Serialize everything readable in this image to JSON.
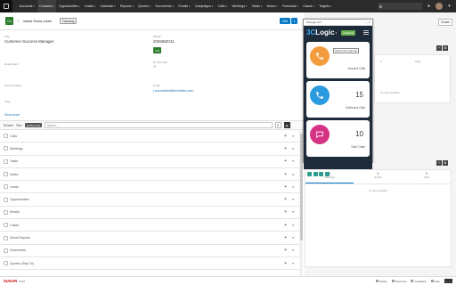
{
  "nav": {
    "items": [
      "Accounts",
      "Contacts",
      "Opportunities",
      "Leads",
      "Calendar",
      "Reports",
      "Quotes",
      "Documents",
      "Emails",
      "Campaigns",
      "Calls",
      "Meetings",
      "Tasks",
      "Notes",
      "Forecasts",
      "Cases",
      "Targets"
    ],
    "active_index": 1
  },
  "record": {
    "icon_text": "Co",
    "name": "Jakob Snow-Lisek",
    "follow_label": "Following",
    "edit_label": "Edit",
    "fields": {
      "title_label": "Title",
      "title_value": "Customer Success Manager",
      "mobile_label": "Mobile",
      "mobile_value": "2025550111",
      "call_label": "Call",
      "department_label": "Department",
      "do_not_call_label": "Do Not Call",
      "do_not_call_value": "☐",
      "account_label": "Account Name",
      "email_label": "Email",
      "email_value": "j.snowsilek@techtalks.com",
      "tags_label": "Tags"
    },
    "show_more": "Show more"
  },
  "subtoolbar": {
    "related_label": "Related",
    "filter_label": "Filter",
    "filter_chip": "All Records",
    "search_placeholder": "Search..."
  },
  "subpanels": [
    "Calls",
    "Meetings",
    "Tasks",
    "Notes",
    "Leads",
    "Opportunities",
    "Emails",
    "Cases",
    "Direct Reports",
    "Documents",
    "Quotes (Ship To)"
  ],
  "right": {
    "create_label": "Create",
    "dash1_tabs": [
      "0",
      "Calls"
    ],
    "dash1_empty": "No data available",
    "dash2_cols": [
      {
        "n": "0",
        "t": "Meetings"
      },
      {
        "n": "0",
        "t": "Emails"
      },
      {
        "n": "0",
        "t": "Calls"
      }
    ],
    "dash2_empty": "No data available"
  },
  "cti": {
    "window_title": "3CLogic CTI",
    "brand_c": "3C",
    "brand_rest": "Logic",
    "status": "Available",
    "tooltip": "Inbound from last call",
    "cards": [
      {
        "number": "",
        "label": "Inbound Calls",
        "color": "#f39c3d"
      },
      {
        "number": "15",
        "label": "Outbound Calls",
        "color": "#2b9be0"
      },
      {
        "number": "10",
        "label": "Total Chats",
        "color": "#d63384"
      }
    ]
  },
  "footer": {
    "brand": "SUGAR",
    "brand_sub": "CRM",
    "links": [
      "Mobile",
      "Shortcuts",
      "Feedback",
      "Help"
    ],
    "call_label": "Call"
  }
}
